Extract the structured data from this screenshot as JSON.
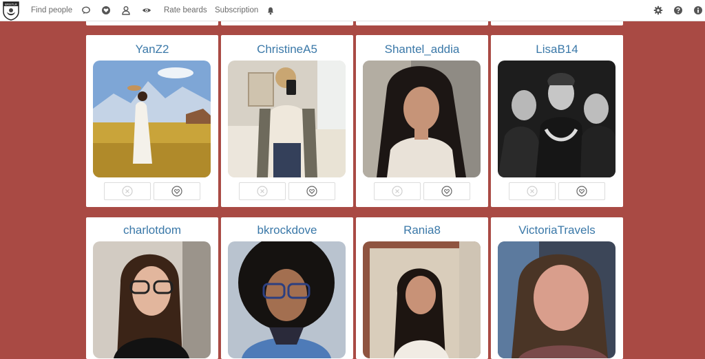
{
  "nav": {
    "logo_text": "BRISTLR",
    "find_people": "Find people",
    "rate_beards": "Rate beards",
    "subscription": "Subscription",
    "icons": [
      "chat-icon",
      "heart-icon",
      "user-icon",
      "eye-icon",
      "bell-icon",
      "gear-icon",
      "help-icon",
      "info-icon"
    ]
  },
  "profiles": [
    {
      "name": "YanZ2"
    },
    {
      "name": "ChristineA5"
    },
    {
      "name": "Shantel_addia"
    },
    {
      "name": "LisaB14"
    },
    {
      "name": "charlotdom"
    },
    {
      "name": "bkrockdove"
    },
    {
      "name": "Rania8"
    },
    {
      "name": "VictoriaTravels"
    }
  ],
  "colors": {
    "background": "#a94a44",
    "username": "#3a78a8",
    "topbar": "#ffffff",
    "nav_text": "#6a6a6a"
  }
}
